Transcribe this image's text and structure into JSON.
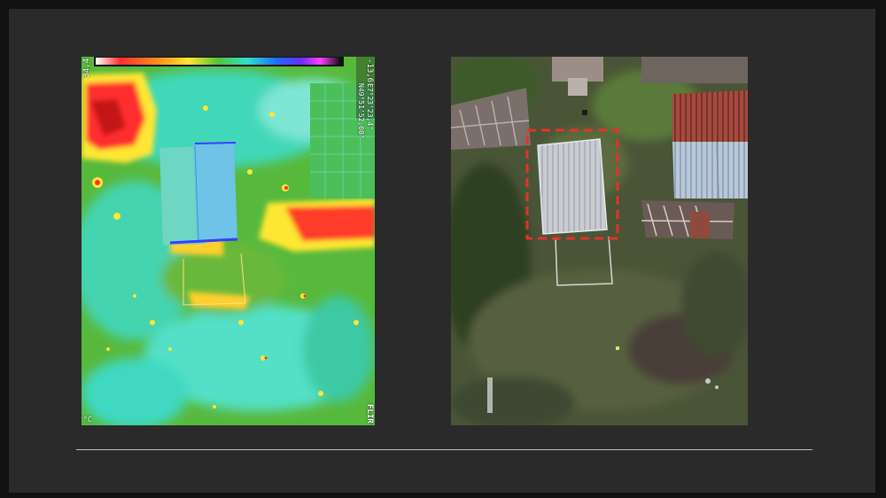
{
  "thermal_image": {
    "scale_max": "34,4",
    "scale_min": "-13,6",
    "latitude": "N49°51'52,00\"",
    "longitude": "E7°23'23,4\"",
    "brand": "FLIR",
    "unit": "°C",
    "palette": [
      "#ff2d2d",
      "#ff8c1a",
      "#ffe633",
      "#55c238",
      "#2fe0c8",
      "#1c6cff",
      "#6b2cff",
      "#ff40ff",
      "#111111"
    ]
  },
  "aerial_image": {
    "highlight_color": "#e8302a"
  },
  "colors": {
    "slide_background": "#2a2a2a",
    "divider": "#bdbdbd"
  }
}
